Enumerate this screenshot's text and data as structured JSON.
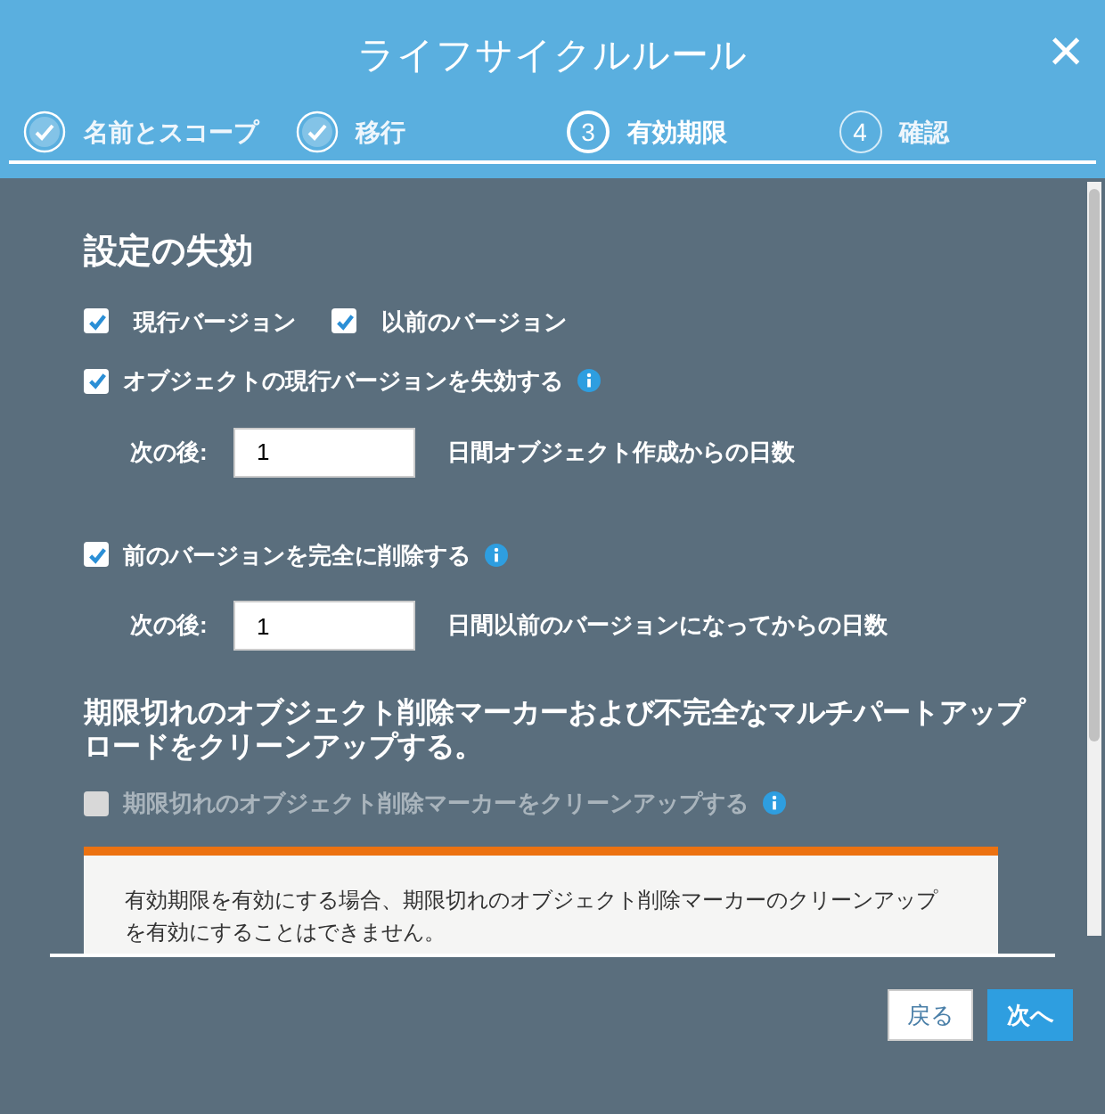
{
  "window": {
    "title": "ライフサイクルルール",
    "close": "×"
  },
  "steps": [
    {
      "label": "名前とスコープ",
      "kind": "done",
      "selected": false
    },
    {
      "label": "移行",
      "kind": "done",
      "selected": false
    },
    {
      "label": "有効期限",
      "number": "3",
      "kind": "todo",
      "selected": true
    },
    {
      "label": "確認",
      "number": "4",
      "kind": "todo",
      "selected": false
    }
  ],
  "section1": {
    "heading": "設定の失効",
    "versions": [
      {
        "label": "現行バージョン",
        "checked": true
      },
      {
        "label": "以前のバージョン",
        "checked": true
      }
    ],
    "rules": [
      {
        "label": "オブジェクトの現行バージョンを失効する",
        "checked": true,
        "after_label": "次の後:",
        "value": "1",
        "unit": "日間オブジェクト作成からの日数"
      },
      {
        "label": "前のバージョンを完全に削除する",
        "checked": true,
        "after_label": "次の後:",
        "value": "1",
        "unit": "日間以前のバージョンになってからの日数"
      }
    ]
  },
  "section2": {
    "heading": "期限切れのオブジェクト削除マーカーおよび不完全なマルチパートアップロードをクリーンアップする。",
    "option": {
      "label": "期限切れのオブジェクト削除マーカーをクリーンアップする",
      "checked": false,
      "disabled": true
    },
    "warning": "有効期限を有効にする場合、期限切れのオブジェクト削除マーカーのクリーンアップを有効にすることはできません。"
  },
  "buttons": [
    {
      "label": "戻る",
      "kind": "secondary"
    },
    {
      "label": "次へ",
      "kind": "primary"
    }
  ]
}
